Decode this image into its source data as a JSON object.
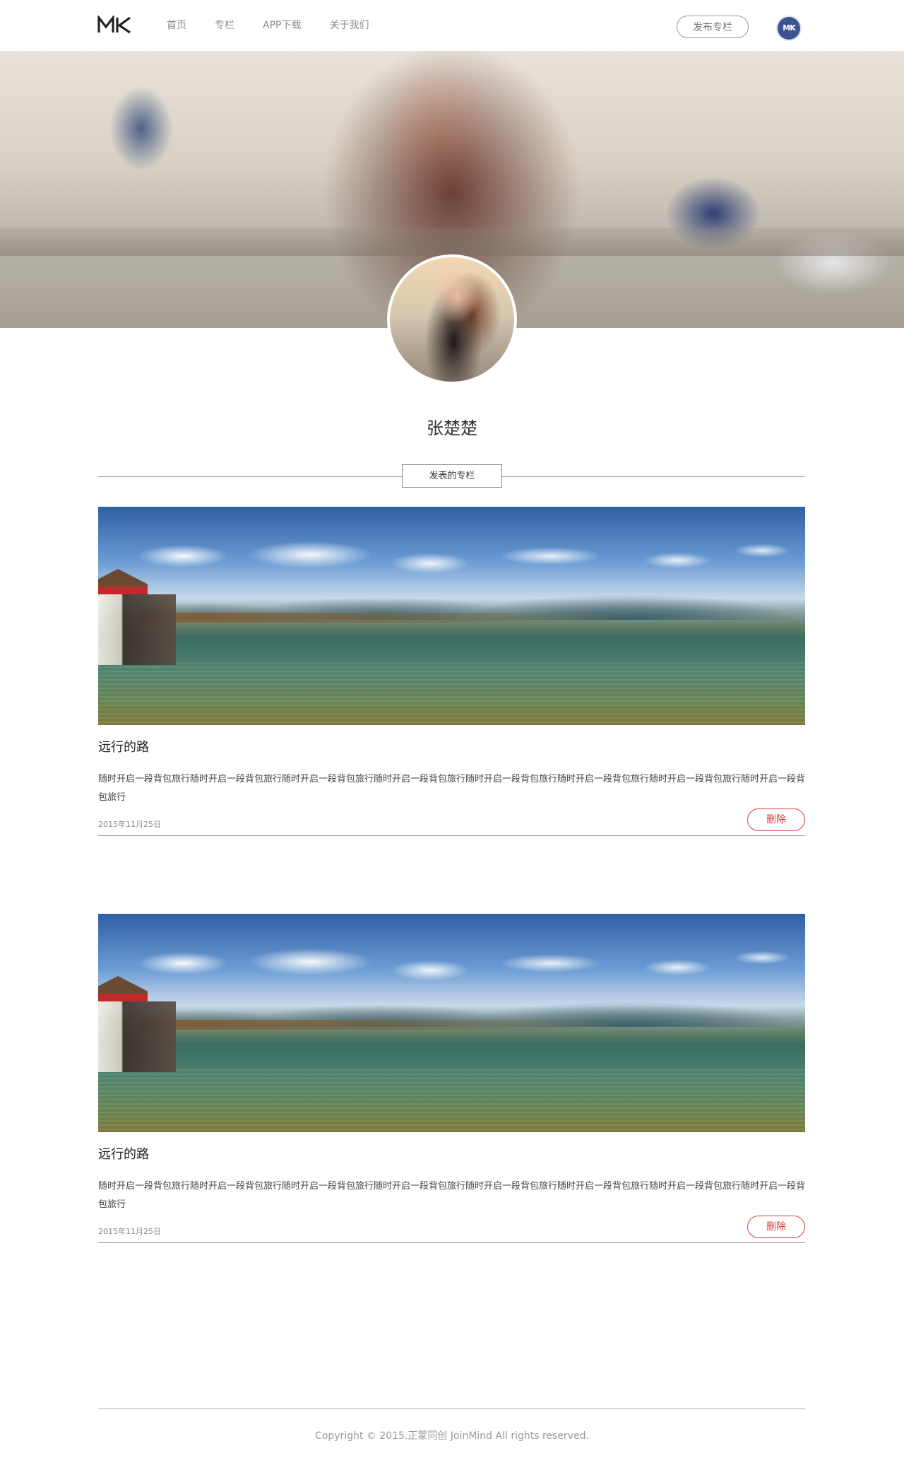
{
  "header": {
    "logo_text": "MK",
    "nav": [
      {
        "label": "首页"
      },
      {
        "label": "专栏"
      },
      {
        "label": "APP下载"
      },
      {
        "label": "关于我们"
      }
    ],
    "publish_label": "发布专栏",
    "avatar_text": "MK"
  },
  "profile": {
    "name": "张楚楚"
  },
  "section": {
    "title": "发表的专栏"
  },
  "articles": [
    {
      "title": "远行的路",
      "body": "随时开启一段背包旅行随时开启一段背包旅行随时开启一段背包旅行随时开启一段背包旅行随时开启一段背包旅行随时开启一段背包旅行随时开启一段背包旅行随时开启一段背包旅行",
      "date": "2015年11月25日",
      "delete_label": "删除"
    },
    {
      "title": "远行的路",
      "body": "随时开启一段背包旅行随时开启一段背包旅行随时开启一段背包旅行随时开启一段背包旅行随时开启一段背包旅行随时开启一段背包旅行随时开启一段背包旅行随时开启一段背包旅行",
      "date": "2015年11月25日",
      "delete_label": "删除"
    }
  ],
  "footer": {
    "copyright": "Copyright © 2015.正蒙同创 JoinMind All rights reserved."
  },
  "colors": {
    "accent_red": "#e03a3a",
    "avatar_blue": "#3c5590",
    "divider_blue": "#7f8fa6"
  }
}
